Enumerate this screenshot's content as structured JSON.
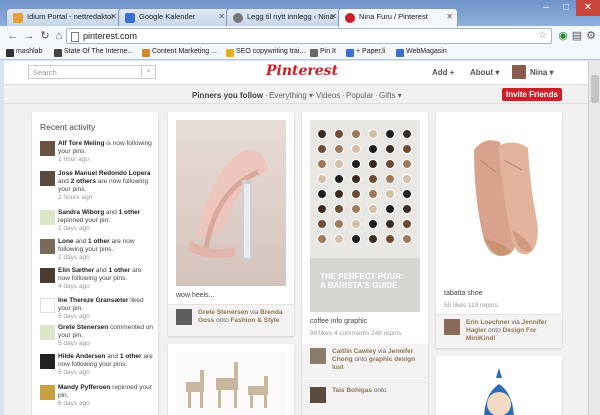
{
  "browser": {
    "tabs": [
      {
        "title": "Idium Portal - nettredaktor",
        "color": "#e5a23a"
      },
      {
        "title": "Google Kalender",
        "color": "#3a6fd1"
      },
      {
        "title": "Legg til nytt innlegg ‹ Nina",
        "color": "#777777"
      },
      {
        "title": "Nina Furu / Pinterest",
        "color": "#cb2027"
      }
    ],
    "url": "pinterest.com",
    "bookmarks": [
      {
        "label": "mashlab",
        "color": "#333333"
      },
      {
        "label": "State Of The Interne...",
        "color": "#444444"
      },
      {
        "label": "Content Marketing ...",
        "color": "#d08a2a"
      },
      {
        "label": "SEO copywriting trai...",
        "color": "#e0b020"
      },
      {
        "label": "Pin It",
        "color": "#666666"
      },
      {
        "label": "+ Paper.li",
        "color": "#3a6fd1"
      },
      {
        "label": "WebMagasin",
        "color": "#3a6fd1"
      }
    ]
  },
  "header": {
    "search_placeholder": "Search",
    "logo": "Pinterest",
    "add": "Add +",
    "about": "About ▾",
    "user": "Nina ▾"
  },
  "subnav": {
    "pinners": "Pinners you follow",
    "everything": "Everything ▾",
    "videos": "Videos",
    "popular": "Popular",
    "gifts": "Gifts ▾",
    "sep": "·",
    "invite": "Invite Friends"
  },
  "activity": {
    "title": "Recent activity",
    "items": [
      {
        "name": "Alf Tore Meling",
        "text": " is now following your pins.",
        "time": "1 hour ago"
      },
      {
        "name": "Jose Manuel Redondo Lopera",
        "text": " and ",
        "extra": "2 others",
        "text2": " are now following your pins.",
        "time": "2 hours ago"
      },
      {
        "name": "Sandra Wiborg",
        "text": " and ",
        "extra": "1 other",
        "text2": " repinned your pin.",
        "time": "2 days ago"
      },
      {
        "name": "Lone",
        "text": " and ",
        "extra": "1 other",
        "text2": " are now following your pins.",
        "time": "2 days ago"
      },
      {
        "name": "Elin Sæther",
        "text": " and ",
        "extra": "1 other",
        "text2": " are now following your pins.",
        "time": "4 days ago"
      },
      {
        "name": "Ine Thereze Gransæter",
        "text": " liked your pin.",
        "time": "5 days ago"
      },
      {
        "name": "Grete Stenersen",
        "text": " commented on your pin.",
        "time": "5 days ago"
      },
      {
        "name": "Hilde Andersen",
        "text": " and ",
        "extra": "1 other",
        "text2": " are now following your pins.",
        "time": "5 days ago"
      },
      {
        "name": "Mandy Pyfferoen",
        "text": " repinned your pin.",
        "time": "6 days ago"
      }
    ]
  },
  "pins": [
    {
      "caption": "wow heels...",
      "via_user": "Grete Stenersen",
      "via_word": "via",
      "via_source": "Brenda Goss",
      "onto_word": "onto",
      "board": "Fashion & Style"
    },
    {
      "caption": "coffee info graphic",
      "stats": "98 likes  4 comments  246 repins",
      "via_user": "Caitlin Cawley",
      "via_word": "via",
      "via_source": "Jennifer Chong",
      "onto_word": "onto",
      "board": "graphic design lust",
      "via_user2": "Tais Bohigas",
      "onto_word2": "onto"
    },
    {
      "caption": "tabatta shoe",
      "stats": "55 likes  119 repins",
      "via_user": "Erin Loechner",
      "via_word": "via",
      "via_source": "Jennifer Hagler",
      "onto_word": "onto",
      "board": "Design For MiniKind!"
    }
  ],
  "infographic": {
    "title": "THE PERFECT POUR: A BARISTA'S GUIDE"
  }
}
